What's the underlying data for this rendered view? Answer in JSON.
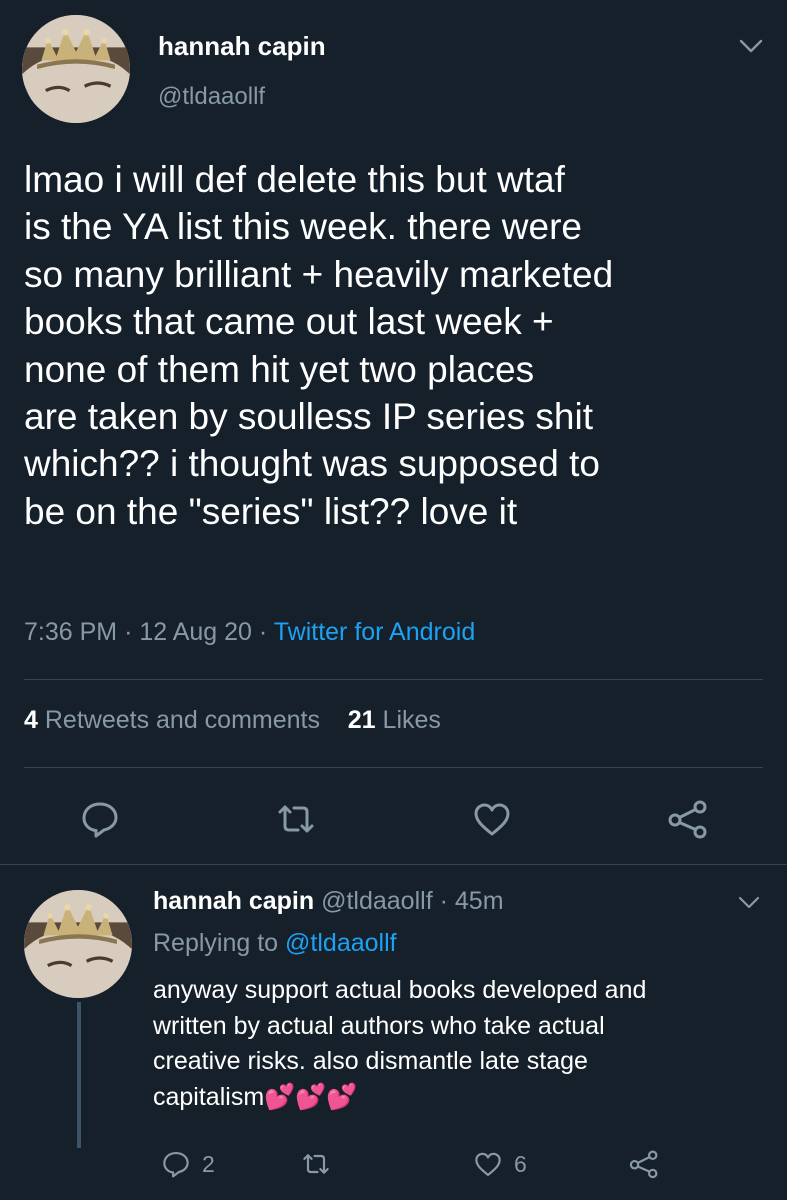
{
  "main_tweet": {
    "author_name": "hannah capin",
    "author_handle": "@tldaaollf",
    "text": "lmao i will def delete this but wtaf\nis the YA list this week. there were\nso many brilliant + heavily marketed\nbooks that came out last week +\nnone of them hit yet two places\nare taken by soulless IP series shit\nwhich?? i thought was supposed to\nbe on the \"series\" list?? love it",
    "time": "7:36 PM",
    "sep1": "·",
    "date": "12 Aug 20",
    "sep2": "·",
    "source": "Twitter for Android",
    "retweets_count": "4",
    "retweets_label": "Retweets and comments",
    "likes_count": "21",
    "likes_label": "Likes"
  },
  "reply_tweet": {
    "author_name": "hannah capin",
    "author_handle": "@tldaaollf",
    "sep": "·",
    "age": "45m",
    "replying_to_label": "Replying to",
    "replying_to_handle": "@tldaaollf",
    "text": "anyway support actual books developed and\nwritten by actual authors who take actual\ncreative risks. also dismantle late stage\ncapitalism💕💕💕",
    "reply_count": "2",
    "like_count": "6"
  },
  "icons": {
    "reply": "reply-bubble-icon",
    "retweet": "retweet-icon",
    "like": "heart-icon",
    "share": "share-icon",
    "menu": "chevron-down-icon"
  },
  "colors": {
    "background": "#15202b",
    "primary_text": "#ffffff",
    "secondary_text": "#8899a6",
    "accent": "#1da1f2",
    "divider": "#38444d"
  }
}
